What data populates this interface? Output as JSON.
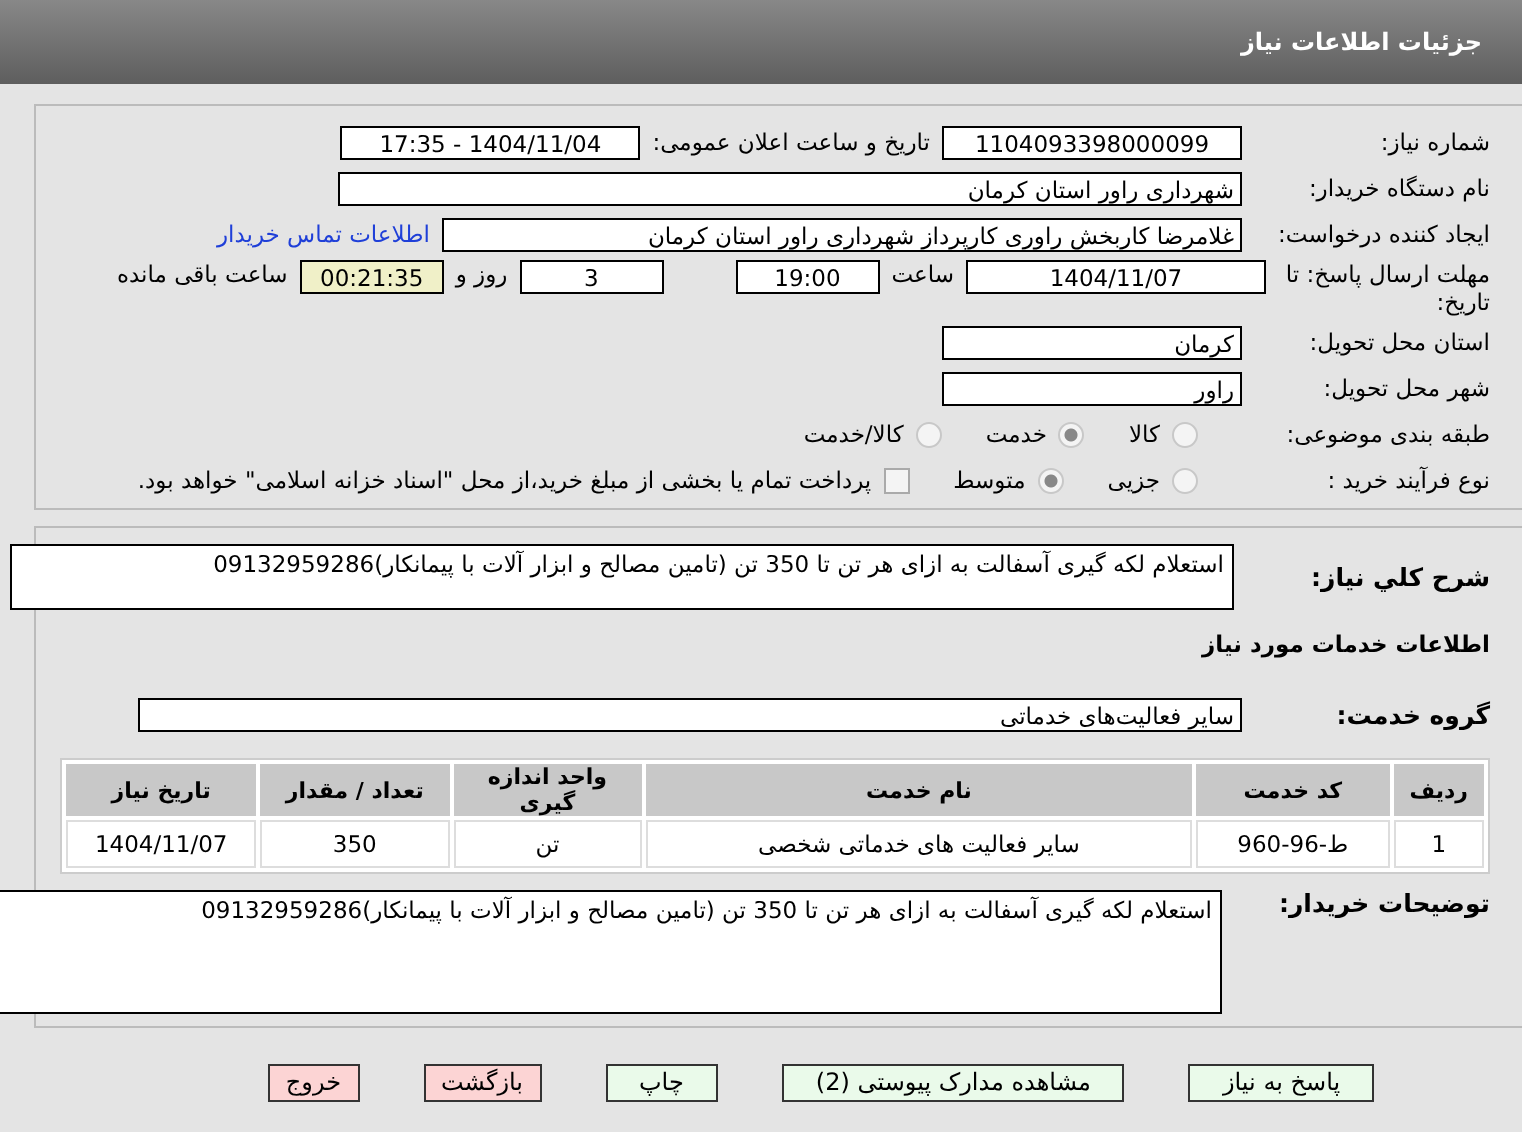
{
  "header": {
    "title": "جزئیات اطلاعات نیاز"
  },
  "need_number": {
    "label": "شماره نیاز:",
    "value": "1104093398000099"
  },
  "announce": {
    "label": "تاریخ و ساعت اعلان عمومی:",
    "value": "1404/11/04 - 17:35"
  },
  "buyer_org": {
    "label": "نام دستگاه خریدار:",
    "value": "شهرداری راور استان کرمان"
  },
  "creator": {
    "label": "ایجاد کننده درخواست:",
    "value": "غلامرضا کاربخش راوری کارپرداز  شهرداری راور استان کرمان",
    "link": "اطلاعات تماس خریدار"
  },
  "deadline": {
    "label": "مهلت ارسال پاسخ: تا تاریخ:",
    "date": "1404/11/07",
    "time_label": "ساعت",
    "time": "19:00",
    "days": "3",
    "days_label": "روز و",
    "remaining": "00:21:35",
    "remaining_label": "ساعت باقی مانده"
  },
  "province": {
    "label": "استان محل تحویل:",
    "value": "کرمان"
  },
  "city": {
    "label": "شهر محل تحویل:",
    "value": "راور"
  },
  "category": {
    "label": "طبقه بندی موضوعی:",
    "options": [
      {
        "label": "کالا",
        "selected": false
      },
      {
        "label": "خدمت",
        "selected": true
      },
      {
        "label": "کالا/خدمت",
        "selected": false
      }
    ]
  },
  "process": {
    "label": "نوع فرآیند خرید :",
    "options": [
      {
        "label": "جزیی",
        "selected": false
      },
      {
        "label": "متوسط",
        "selected": true
      }
    ],
    "payment": {
      "checked": false,
      "text": "پرداخت تمام یا بخشی از مبلغ خرید،از محل \"اسناد خزانه اسلامی\" خواهد بود."
    }
  },
  "summary": {
    "label": "شرح کلي نياز:",
    "value": "استعلام لکه گیری آسفالت به ازای هر تن تا 350 تن (تامین مصالح و ابزار آلات با پیمانکار)09132959286"
  },
  "services_heading": "اطلاعات خدمات مورد نیاز",
  "service_group": {
    "label": "گروه خدمت:",
    "value": "سایر فعالیت‌های خدماتی"
  },
  "table": {
    "columns": [
      "ردیف",
      "کد خدمت",
      "نام خدمت",
      "واحد اندازه گیری",
      "تعداد / مقدار",
      "تاریخ نیاز"
    ],
    "rows": [
      [
        "1",
        "ط-96-960",
        "سایر فعالیت های خدماتی شخصی",
        "تن",
        "350",
        "1404/11/07"
      ]
    ]
  },
  "buyer_notes": {
    "label": "توضیحات خریدار:",
    "value": "استعلام لکه گیری آسفالت به ازای هر تن تا 350 تن (تامین مصالح و ابزار آلات با پیمانکار)09132959286"
  },
  "buttons": [
    {
      "label": "پاسخ به نیاز",
      "kind": "primary"
    },
    {
      "label": "مشاهده مدارک پیوستی (2)",
      "kind": "primary"
    },
    {
      "label": "چاپ",
      "kind": "primary"
    },
    {
      "label": "بازگشت",
      "kind": "danger"
    },
    {
      "label": "خروج",
      "kind": "danger"
    }
  ]
}
